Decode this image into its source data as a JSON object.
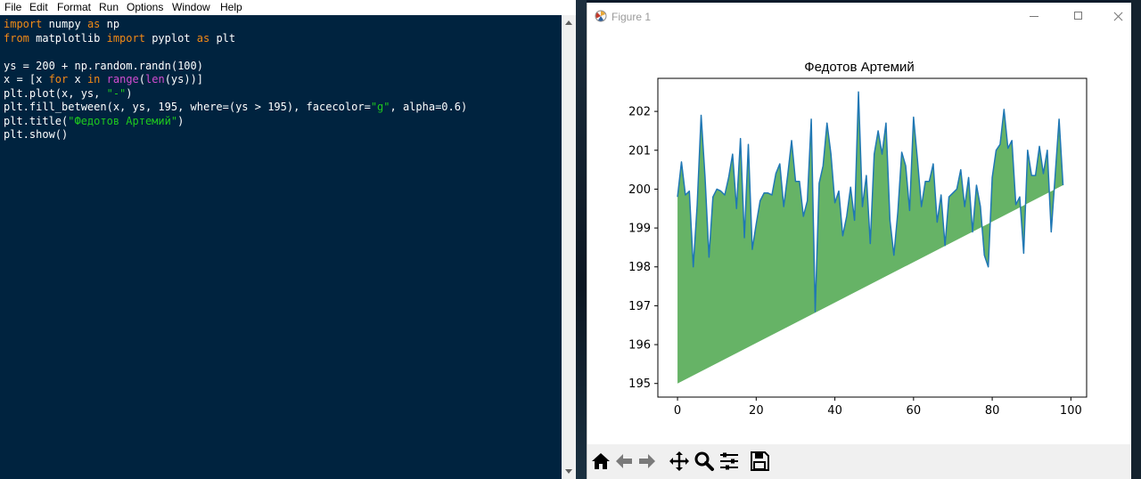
{
  "editor": {
    "menu": [
      "File",
      "Edit",
      "Format",
      "Run",
      "Options",
      "Window",
      "Help"
    ],
    "code_lines": [
      [
        {
          "t": "import",
          "c": "kw"
        },
        {
          "t": " numpy ",
          "c": ""
        },
        {
          "t": "as",
          "c": "kw"
        },
        {
          "t": " np",
          "c": ""
        }
      ],
      [
        {
          "t": "from",
          "c": "kw"
        },
        {
          "t": " matplotlib ",
          "c": ""
        },
        {
          "t": "import",
          "c": "kw"
        },
        {
          "t": " pyplot ",
          "c": ""
        },
        {
          "t": "as",
          "c": "kw"
        },
        {
          "t": " plt",
          "c": ""
        }
      ],
      [],
      [
        {
          "t": "ys = 200 + np.random.randn(100)",
          "c": ""
        }
      ],
      [
        {
          "t": "x = [x ",
          "c": ""
        },
        {
          "t": "for",
          "c": "kw"
        },
        {
          "t": " x ",
          "c": ""
        },
        {
          "t": "in",
          "c": "kw"
        },
        {
          "t": " ",
          "c": ""
        },
        {
          "t": "range",
          "c": "kw2"
        },
        {
          "t": "(",
          "c": ""
        },
        {
          "t": "len",
          "c": "kw2"
        },
        {
          "t": "(ys))]",
          "c": ""
        }
      ],
      [
        {
          "t": "plt.plot(x, ys, ",
          "c": ""
        },
        {
          "t": "\"-\"",
          "c": "str"
        },
        {
          "t": ")",
          "c": ""
        }
      ],
      [
        {
          "t": "plt.fill_between(x, ys, 195, where=(ys > 195), facecolor=",
          "c": ""
        },
        {
          "t": "\"g\"",
          "c": "str"
        },
        {
          "t": ", alpha=0.6)",
          "c": ""
        }
      ],
      [
        {
          "t": "plt.title(",
          "c": ""
        },
        {
          "t": "\"Федотов Артемий\"",
          "c": "str"
        },
        {
          "t": ")",
          "c": ""
        }
      ],
      [
        {
          "t": "plt.show()",
          "c": ""
        }
      ]
    ]
  },
  "figure": {
    "window_title": "Figure 1",
    "toolbar_icons": [
      "home-icon",
      "back-arrow-icon",
      "forward-arrow-icon",
      "pan-icon",
      "zoom-icon",
      "configure-subplots-icon",
      "save-icon"
    ]
  },
  "colors": {
    "line": "#1f77b4",
    "fill": "#008000",
    "editor_bg": "#00233f",
    "keyword": "#f28a16",
    "builtin": "#d24dd2",
    "string": "#1ec81e"
  },
  "chart_data": {
    "type": "area",
    "title": "Федотов Артемий",
    "xlabel": "",
    "ylabel": "",
    "xlim": [
      -5,
      104
    ],
    "ylim": [
      194.65,
      202.85
    ],
    "xticks": [
      0,
      20,
      40,
      60,
      80,
      100
    ],
    "yticks": [
      195,
      196,
      197,
      198,
      199,
      200,
      201,
      202
    ],
    "fill_baseline": 195,
    "fill_alpha": 0.6,
    "grid": false,
    "x": [
      0,
      1,
      2,
      3,
      4,
      5,
      6,
      7,
      8,
      9,
      10,
      11,
      12,
      13,
      14,
      15,
      16,
      17,
      18,
      19,
      20,
      21,
      22,
      23,
      24,
      25,
      26,
      27,
      28,
      29,
      30,
      31,
      32,
      33,
      34,
      35,
      36,
      37,
      38,
      39,
      40,
      41,
      42,
      43,
      44,
      45,
      46,
      47,
      48,
      49,
      50,
      51,
      52,
      53,
      54,
      55,
      56,
      57,
      58,
      59,
      60,
      61,
      62,
      63,
      64,
      65,
      66,
      67,
      68,
      69,
      70,
      71,
      72,
      73,
      74,
      75,
      76,
      77,
      78,
      79,
      80,
      81,
      82,
      83,
      84,
      85,
      86,
      87,
      88,
      89,
      90,
      91,
      92,
      93,
      94,
      95,
      96,
      97,
      98,
      99
    ],
    "series": [
      {
        "values": [
          199.8,
          200.7,
          199.85,
          199.95,
          198.0,
          199.6,
          201.9,
          200.3,
          198.25,
          199.8,
          200.0,
          199.95,
          199.85,
          200.3,
          200.9,
          199.5,
          201.3,
          198.75,
          201.15,
          198.45,
          199.1,
          199.7,
          199.9,
          199.9,
          199.85,
          200.4,
          200.65,
          199.55,
          200.35,
          201.25,
          200.2,
          200.2,
          199.3,
          199.7,
          201.8,
          196.85,
          200.15,
          200.6,
          201.7,
          200.9,
          199.65,
          199.95,
          198.8,
          199.3,
          200.05,
          199.2,
          202.5,
          199.55,
          200.35,
          198.6,
          200.9,
          201.5,
          200.9,
          201.7,
          199.2,
          198.3,
          199.4,
          200.95,
          200.6,
          199.45,
          201.85,
          200.75,
          199.55,
          200.2,
          200.2,
          200.65,
          199.15,
          199.85,
          198.55,
          199.8,
          199.9,
          200.0,
          200.5,
          199.55,
          200.3,
          198.9,
          200.1,
          199.55,
          198.3,
          198.0,
          200.3,
          201.0,
          201.15,
          202.05,
          201.05,
          201.25,
          199.6,
          199.8,
          198.35,
          201.0,
          200.35,
          200.35,
          201.1,
          200.4,
          201.0,
          198.9,
          200.35,
          201.8,
          200.1
        ]
      }
    ]
  }
}
